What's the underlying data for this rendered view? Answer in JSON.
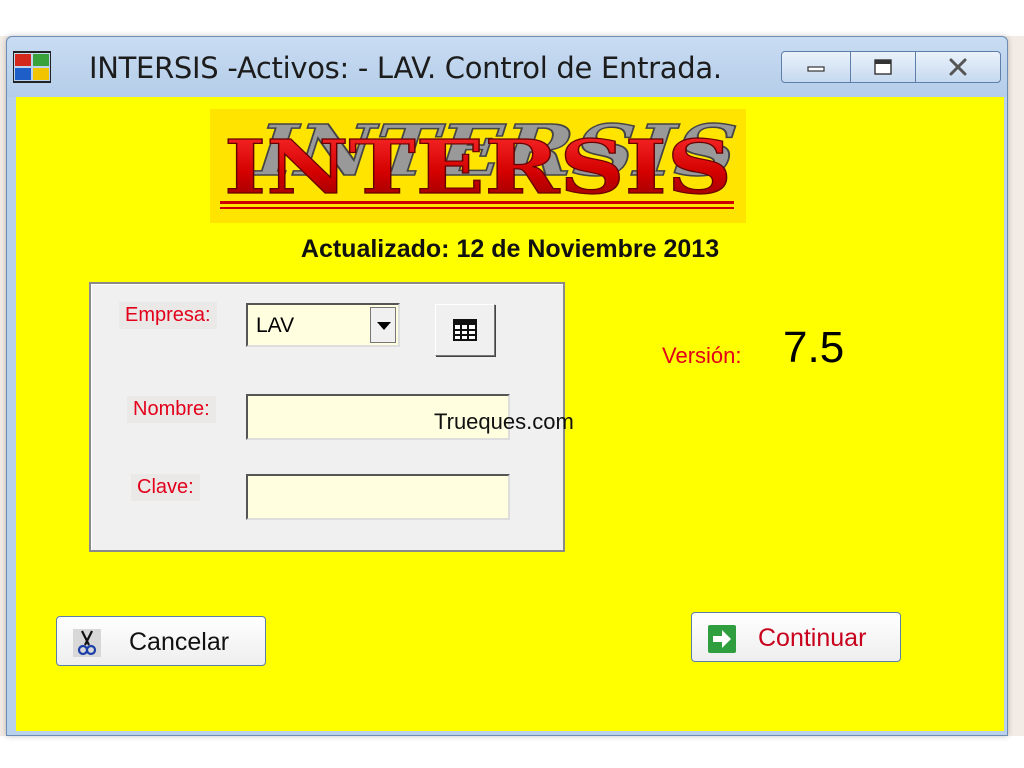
{
  "window": {
    "title": "INTERSIS -Activos:  - LAV. Control de Entrada."
  },
  "logo": {
    "text": "INTERSIS"
  },
  "header": {
    "updated": "Actualizado: 12 de Noviembre 2013"
  },
  "form": {
    "empresa_label": "Empresa:",
    "empresa_value": "LAV",
    "nombre_label": "Nombre:",
    "nombre_value": "",
    "clave_label": "Clave:",
    "clave_value": ""
  },
  "watermark": "Trueques.com",
  "version": {
    "label": "Versión:",
    "value": "7.5"
  },
  "buttons": {
    "cancel_label": "Cancelar",
    "continue_label": "Continuar"
  },
  "icons": {
    "app": "windows-flag-icon",
    "cancel": "scissors-icon",
    "continue": "green-arrow-right-icon",
    "grid": "table-grid-icon"
  },
  "colors": {
    "client_background": "#ffff00",
    "label_red": "#e2001a",
    "input_background": "#ffffe0",
    "continue_arrow": "#2e9e3e"
  }
}
